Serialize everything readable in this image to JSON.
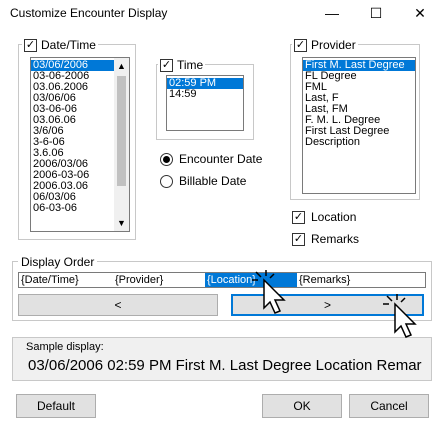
{
  "window": {
    "title": "Customize Encounter Display",
    "minimize": "—",
    "maximize": "☐",
    "close": "✕"
  },
  "date_time": {
    "label": "Date/Time",
    "checked": true,
    "formats": [
      "03/06/2006",
      "03-06-2006",
      "03.06.2006",
      "03/06/06",
      "03-06-06",
      "03.06.06",
      "3/6/06",
      "3-6-06",
      "3.6.06",
      "2006/03/06",
      "2006-03-06",
      "2006.03.06",
      "06/03/06",
      "06-03-06"
    ],
    "selected_index": 0
  },
  "time": {
    "label": "Time",
    "checked": true,
    "formats": [
      "02:59 PM",
      "14:59"
    ],
    "selected_index": 0
  },
  "date_source": {
    "options": [
      "Encounter Date",
      "Billable Date"
    ],
    "selected_index": 0
  },
  "provider": {
    "label": "Provider",
    "checked": true,
    "formats": [
      "First M. Last Degree",
      "FL Degree",
      "FML",
      "Last, F",
      "Last, FM",
      "F. M. L. Degree",
      "First Last Degree",
      "Description"
    ],
    "selected_index": 0
  },
  "location": {
    "label": "Location",
    "checked": true
  },
  "remarks": {
    "label": "Remarks",
    "checked": true
  },
  "display_order": {
    "label": "Display Order",
    "items": [
      "{Date/Time}",
      "{Provider}",
      "{Location}",
      "{Remarks}"
    ],
    "selected_index": 2,
    "left_button": "<",
    "right_button": ">"
  },
  "sample": {
    "label": "Sample display:",
    "text": "03/06/2006 02:59 PM  First M. Last Degree Location Remar"
  },
  "buttons": {
    "default": "Default",
    "ok": "OK",
    "cancel": "Cancel"
  }
}
